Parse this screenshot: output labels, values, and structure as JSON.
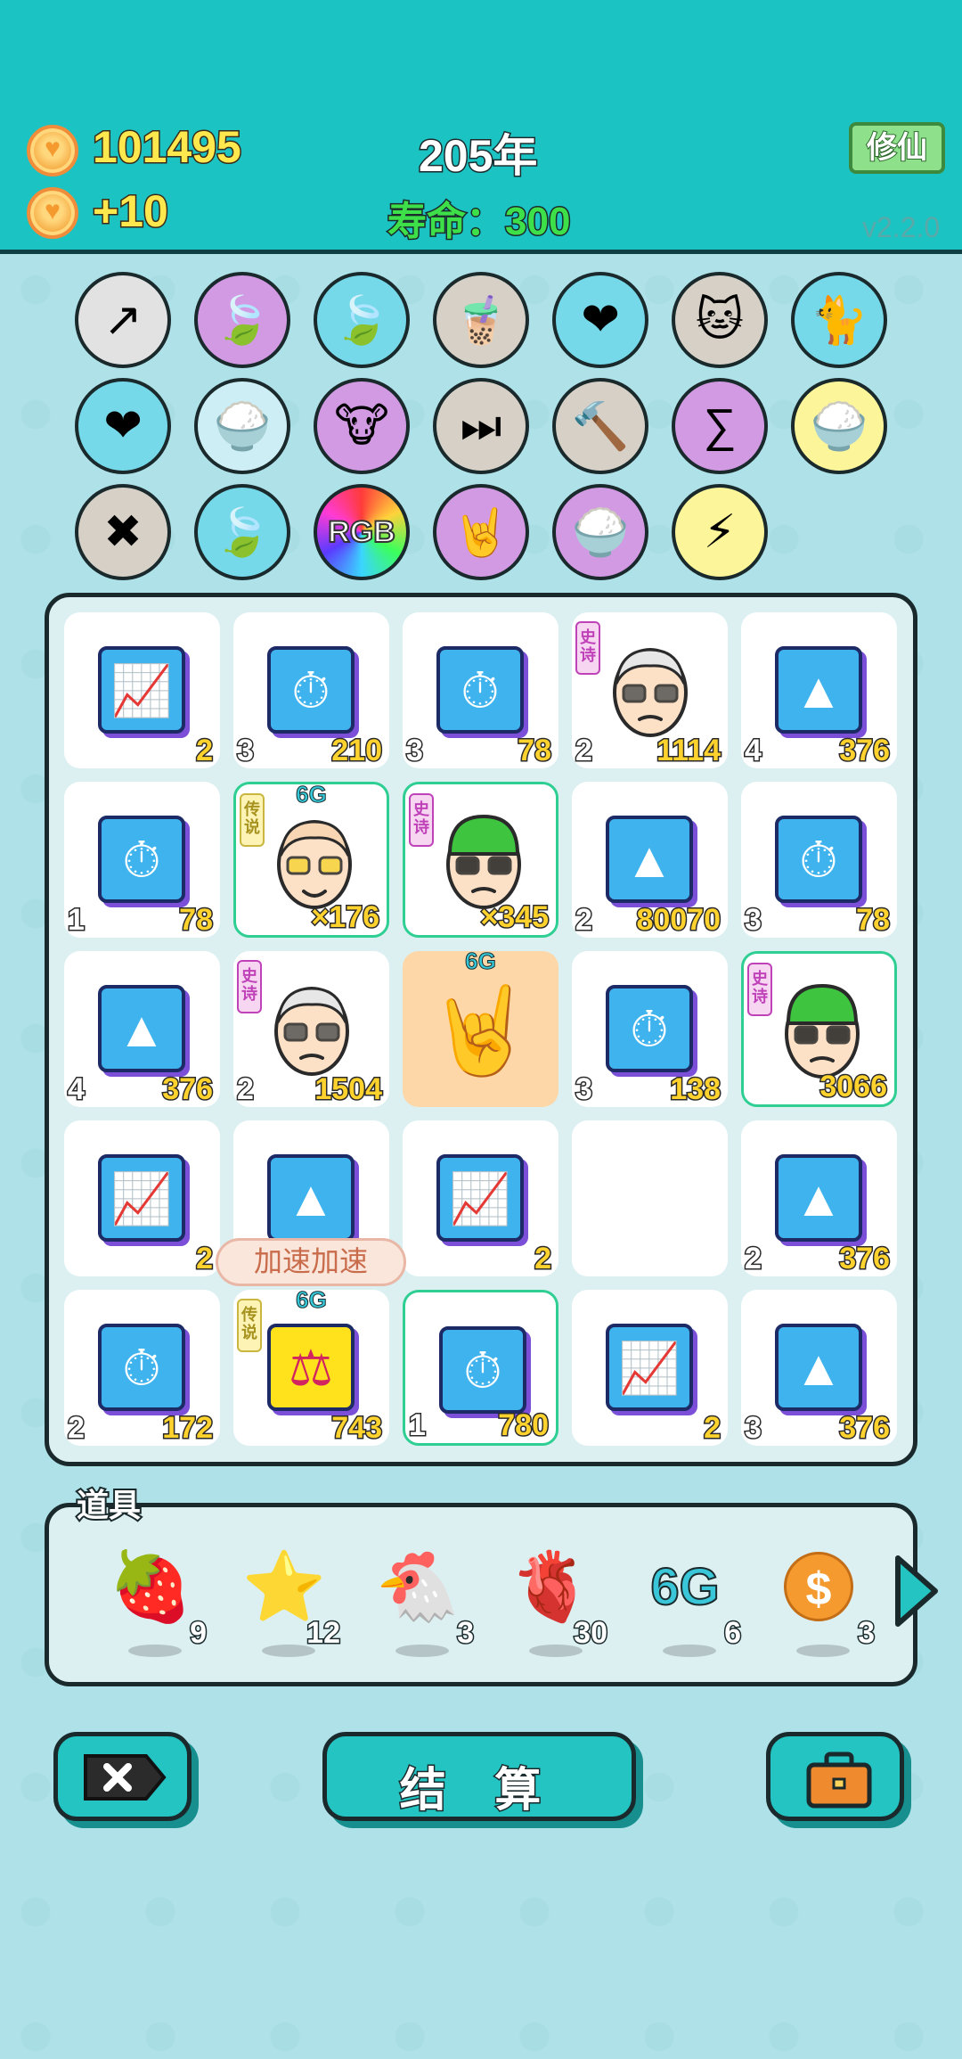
{
  "header": {
    "coins": "101495",
    "income": "+10",
    "year": "205年",
    "lifespan": "寿命：300",
    "cultivate_button": "修仙",
    "version": "v2.2.0"
  },
  "skills": [
    {
      "icon": "upgrade-arrow",
      "color": "#e2e2e2"
    },
    {
      "icon": "leaf",
      "color": "#d39ae4"
    },
    {
      "icon": "leaf",
      "color": "#76d9ea"
    },
    {
      "icon": "bubble-tea",
      "color": "#d6d0c6"
    },
    {
      "icon": "blood-bag",
      "color": "#76d9ea"
    },
    {
      "icon": "cats",
      "color": "#d6d0c6"
    },
    {
      "icon": "cat",
      "color": "#76d9ea"
    },
    {
      "icon": "blood-bag",
      "color": "#76d9ea"
    },
    {
      "icon": "rice-bowl",
      "color": "#cdeef4"
    },
    {
      "icon": "cow-tv",
      "color": "#d39ae4"
    },
    {
      "icon": "skip",
      "color": "#d6d0c6"
    },
    {
      "icon": "hammer",
      "color": "#d6d0c6"
    },
    {
      "icon": "math-head",
      "color": "#d39ae4"
    },
    {
      "icon": "rice-bowl",
      "color": "#fdf59a"
    },
    {
      "icon": "delete-tag",
      "color": "#d6d0c6"
    },
    {
      "icon": "leaf",
      "color": "#76d9ea"
    },
    {
      "icon": "rgb",
      "color": "#ffffff",
      "label": "RGB"
    },
    {
      "icon": "rock-hand",
      "color": "#d39ae4"
    },
    {
      "icon": "rice-bowl",
      "color": "#d39ae4"
    },
    {
      "icon": "lightning",
      "color": "#fdf59a"
    }
  ],
  "grid": [
    [
      {
        "type": "chart",
        "count": "2"
      },
      {
        "type": "timer",
        "level": "3",
        "count": "210"
      },
      {
        "type": "timer",
        "level": "3",
        "count": "78"
      },
      {
        "type": "old-man",
        "rarity": "史诗",
        "level": "2",
        "count": "1114"
      },
      {
        "type": "gold",
        "level": "4",
        "count": "376"
      }
    ],
    [
      {
        "type": "timer",
        "level": "1",
        "count": "78"
      },
      {
        "type": "bald-man",
        "rarity": "传说",
        "tag": "6G",
        "count": "×176",
        "highlight": true
      },
      {
        "type": "green-hat-man",
        "rarity": "史诗",
        "count": "×345",
        "highlight": true
      },
      {
        "type": "gold",
        "level": "2",
        "count": "80070"
      },
      {
        "type": "timer",
        "level": "3",
        "count": "78"
      }
    ],
    [
      {
        "type": "gold",
        "level": "4",
        "count": "376"
      },
      {
        "type": "old-man",
        "rarity": "史诗",
        "level": "2",
        "count": "1504"
      },
      {
        "type": "rock-hand",
        "tag": "6G",
        "orange": true
      },
      {
        "type": "timer",
        "level": "3",
        "count": "138"
      },
      {
        "type": "green-hat-man",
        "rarity": "史诗",
        "count": "3066",
        "highlight": true
      }
    ],
    [
      {
        "type": "chart",
        "count": "2"
      },
      {
        "type": "gold"
      },
      {
        "type": "chart",
        "count": "2"
      },
      {
        "type": "empty"
      },
      {
        "type": "gold",
        "level": "2",
        "count": "376"
      }
    ],
    [
      {
        "type": "timer",
        "level": "2",
        "count": "172"
      },
      {
        "type": "scale",
        "rarity": "传说",
        "tag": "6G",
        "count": "743"
      },
      {
        "type": "timer",
        "level": "1",
        "count": "780",
        "highlight": true
      },
      {
        "type": "chart",
        "count": "2"
      },
      {
        "type": "gold",
        "level": "3",
        "count": "376"
      }
    ]
  ],
  "speed_popup": "加速加速",
  "items": {
    "title": "道具",
    "list": [
      {
        "icon": "lychee",
        "count": "9"
      },
      {
        "icon": "star",
        "count": "12"
      },
      {
        "icon": "chicken",
        "count": "3"
      },
      {
        "icon": "liver",
        "count": "30"
      },
      {
        "icon": "6g",
        "label": "6G",
        "count": "6"
      },
      {
        "icon": "dollar-coin",
        "count": "3"
      }
    ]
  },
  "buttons": {
    "settle": "结 算"
  }
}
